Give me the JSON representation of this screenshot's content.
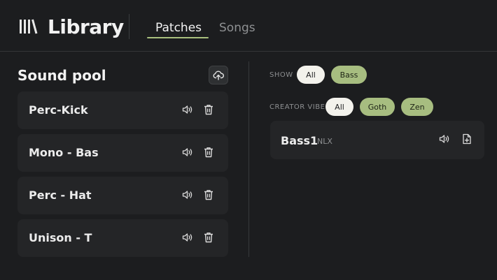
{
  "header": {
    "logo_icon": "library-icon",
    "title": "Library",
    "tabs": [
      {
        "label": "Patches",
        "active": true
      },
      {
        "label": "Songs",
        "active": false
      }
    ]
  },
  "sound_pool": {
    "title": "Sound pool",
    "upload_icon": "cloud-upload-icon",
    "items": [
      {
        "label": "Perc-Kick"
      },
      {
        "label": "Mono - Bas"
      },
      {
        "label": "Perc - Hat"
      },
      {
        "label": "Unison - T"
      }
    ],
    "item_icons": [
      "speaker-icon",
      "trash-icon"
    ]
  },
  "filters": {
    "show": {
      "label": "SHOW",
      "options": [
        {
          "label": "All",
          "selected": true
        },
        {
          "label": "Bass",
          "selected": true
        }
      ]
    },
    "creator_vibe": {
      "label": "CREATOR VIBE",
      "options": [
        {
          "label": "All",
          "selected": true
        },
        {
          "label": "Goth",
          "selected": true
        },
        {
          "label": "Zen",
          "selected": true
        }
      ]
    }
  },
  "patches": [
    {
      "name": "Bass1",
      "creator": "· NLX"
    }
  ],
  "colors": {
    "background": "#1c1d1f",
    "card": "#242527",
    "accent_green": "#a7bd80",
    "pill_white": "#f3f2ec"
  }
}
